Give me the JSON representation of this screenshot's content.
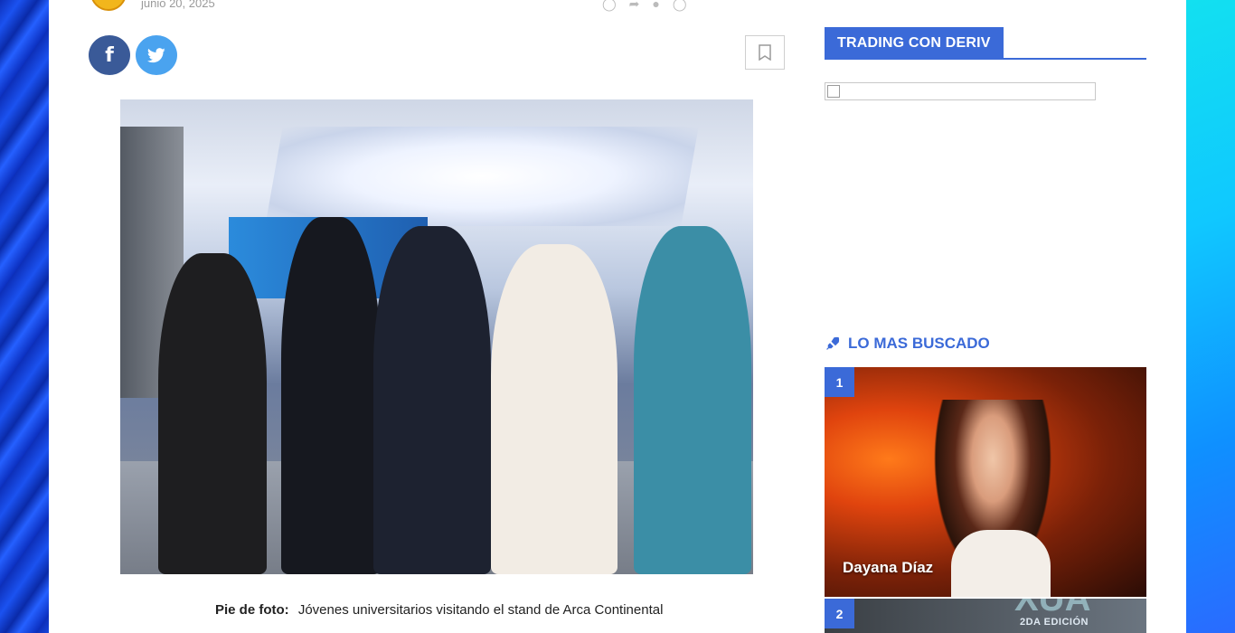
{
  "post": {
    "date": "junio 20, 2025",
    "caption_label": "Pie de foto:",
    "caption_text": "Jóvenes universitarios visitando el stand de Arca Continental"
  },
  "share": {
    "facebook_icon": "f",
    "twitter_icon": "twitter-bird"
  },
  "colors": {
    "accent": "#3b6ad8",
    "facebook": "#3a5a98",
    "twitter": "#4aa3ef"
  },
  "sidebar": {
    "widget1_title": "TRADING CON DERIV",
    "widget2_title": "LO MAS BUSCADO",
    "items": [
      {
        "rank": "1",
        "label": "Dayana Díaz"
      },
      {
        "rank": "2",
        "label": "",
        "badge_text": "2DA EDICIÓN"
      }
    ]
  }
}
